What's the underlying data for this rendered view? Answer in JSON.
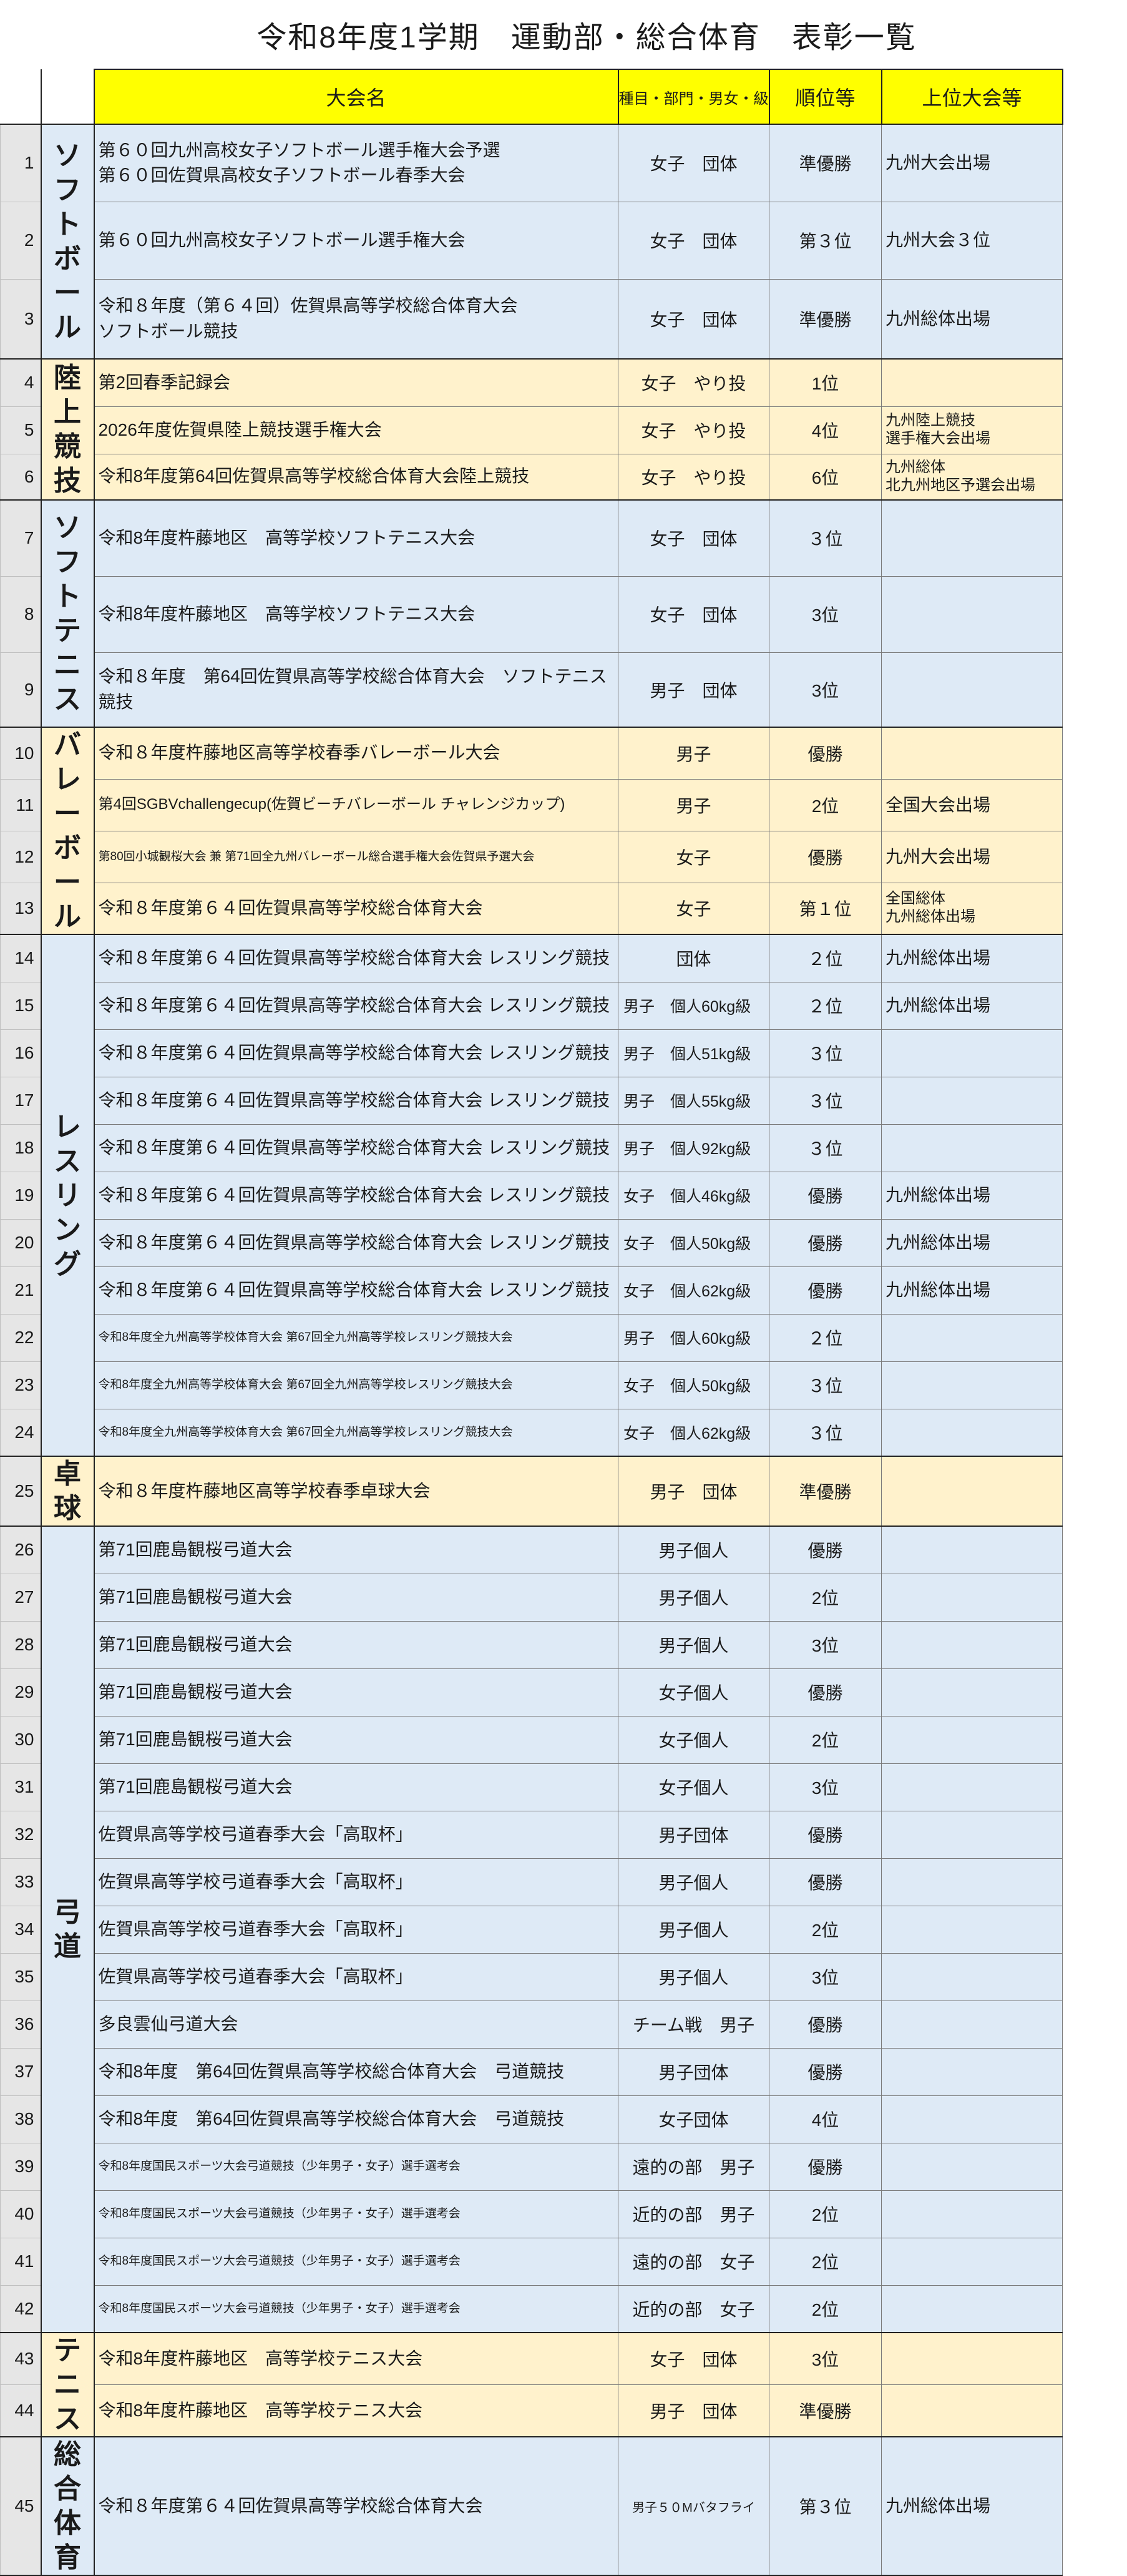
{
  "title": "令和8年度1学期　運動部・総合体育　表彰一覧",
  "columns": {
    "competition": "大会名",
    "category": "種目・部門・男女・級",
    "rank": "順位等",
    "upper": "上位大会等"
  },
  "colors": {
    "header": "#ffff00",
    "blue_group": "#deeaf6",
    "yellow_group": "#fff2cc",
    "number_column": "#e6e6e6"
  },
  "groups": [
    {
      "sport": "ソフトボール",
      "color": "blue",
      "rows": [
        {
          "no": "1",
          "competition": [
            "第６０回九州高校女子ソフトボール選手権大会予選",
            "第６０回佐賀県高校女子ソフトボール春季大会"
          ],
          "category": "女子　団体",
          "rank": "準優勝",
          "upper": [
            "九州大会出場"
          ]
        },
        {
          "no": "2",
          "competition": [
            "第６０回九州高校女子ソフトボール選手権大会"
          ],
          "category": "女子　団体",
          "rank": "第３位",
          "upper": [
            "九州大会３位"
          ]
        },
        {
          "no": "3",
          "competition": [
            "令和８年度（第６４回）佐賀県高等学校総合体育大会",
            "ソフトボール競技"
          ],
          "category": "女子　団体",
          "rank": "準優勝",
          "upper": [
            "九州総体出場"
          ]
        }
      ]
    },
    {
      "sport": "陸上競技",
      "color": "yellow",
      "rows": [
        {
          "no": "4",
          "competition": [
            "第2回春季記録会"
          ],
          "category": "女子　やり投",
          "rank": "1位",
          "upper": []
        },
        {
          "no": "5",
          "competition": [
            "2026年度佐賀県陸上競技選手権大会"
          ],
          "category": "女子　やり投",
          "rank": "4位",
          "upper": [
            "九州陸上競技",
            "選手権大会出場"
          ]
        },
        {
          "no": "6",
          "competition": [
            "令和8年度第64回佐賀県高等学校総合体育大会陸上競技"
          ],
          "category": "女子　やり投",
          "rank": "6位",
          "upper": [
            "九州総体",
            "北九州地区予選会出場"
          ]
        }
      ]
    },
    {
      "sport": "ソフトテニス",
      "color": "blue",
      "rows": [
        {
          "no": "7",
          "competition": [
            "令和8年度杵藤地区　高等学校ソフトテニス大会"
          ],
          "category": "女子　団体",
          "rank": "３位",
          "upper": []
        },
        {
          "no": "8",
          "competition": [
            "令和8年度杵藤地区　高等学校ソフトテニス大会"
          ],
          "category": "女子　団体",
          "rank": "3位",
          "upper": []
        },
        {
          "no": "9",
          "competition": [
            "令和８年度　第64回佐賀県高等学校総合体育大会　ソフトテニス",
            "競技"
          ],
          "category": "男子　団体",
          "rank": "3位",
          "upper": []
        }
      ]
    },
    {
      "sport": "バレーボール",
      "color": "yellow",
      "rows": [
        {
          "no": "10",
          "competition": [
            "令和８年度杵藤地区高等学校春季バレーボール大会"
          ],
          "category": "男子",
          "rank": "優勝",
          "upper": []
        },
        {
          "no": "11",
          "competition": [
            "第4回SGBVchallengecup(佐賀ビーチバレーボール チャレンジカップ)"
          ],
          "category": "男子",
          "rank": "2位",
          "upper": [
            "全国大会出場"
          ]
        },
        {
          "no": "12",
          "competition": [
            "第80回小城観桜大会 兼 第71回全九州バレーボール総合選手権大会佐賀県予選大会"
          ],
          "category": "女子",
          "rank": "優勝",
          "upper": [
            "九州大会出場"
          ]
        },
        {
          "no": "13",
          "competition": [
            "令和８年度第６４回佐賀県高等学校総合体育大会"
          ],
          "category": "女子",
          "rank": "第１位",
          "upper": [
            "全国総体",
            "九州総体出場"
          ]
        }
      ]
    },
    {
      "sport": "レスリング",
      "color": "blue",
      "rows": [
        {
          "no": "14",
          "competition": [
            "令和８年度第６４回佐賀県高等学校総合体育大会 レスリング競技"
          ],
          "category": "団体",
          "rank": "２位",
          "upper": [
            "九州総体出場"
          ]
        },
        {
          "no": "15",
          "competition": [
            "令和８年度第６４回佐賀県高等学校総合体育大会 レスリング競技"
          ],
          "category": "男子　個人60kg級",
          "rank": "２位",
          "upper": [
            "九州総体出場"
          ]
        },
        {
          "no": "16",
          "competition": [
            "令和８年度第６４回佐賀県高等学校総合体育大会 レスリング競技"
          ],
          "category": "男子　個人51kg級",
          "rank": "３位",
          "upper": []
        },
        {
          "no": "17",
          "competition": [
            "令和８年度第６４回佐賀県高等学校総合体育大会 レスリング競技"
          ],
          "category": "男子　個人55kg級",
          "rank": "３位",
          "upper": []
        },
        {
          "no": "18",
          "competition": [
            "令和８年度第６４回佐賀県高等学校総合体育大会 レスリング競技"
          ],
          "category": "男子　個人92kg級",
          "rank": "３位",
          "upper": []
        },
        {
          "no": "19",
          "competition": [
            "令和８年度第６４回佐賀県高等学校総合体育大会 レスリング競技"
          ],
          "category": "女子　個人46kg級",
          "rank": "優勝",
          "upper": [
            "九州総体出場"
          ]
        },
        {
          "no": "20",
          "competition": [
            "令和８年度第６４回佐賀県高等学校総合体育大会 レスリング競技"
          ],
          "category": "女子　個人50kg級",
          "rank": "優勝",
          "upper": [
            "九州総体出場"
          ]
        },
        {
          "no": "21",
          "competition": [
            "令和８年度第６４回佐賀県高等学校総合体育大会 レスリング競技"
          ],
          "category": "女子　個人62kg級",
          "rank": "優勝",
          "upper": [
            "九州総体出場"
          ]
        },
        {
          "no": "22",
          "competition": [
            "令和8年度全九州高等学校体育大会 第67回全九州高等学校レスリング競技大会"
          ],
          "category": "男子　個人60kg級",
          "rank": "２位",
          "upper": []
        },
        {
          "no": "23",
          "competition": [
            "令和8年度全九州高等学校体育大会 第67回全九州高等学校レスリング競技大会"
          ],
          "category": "女子　個人50kg級",
          "rank": "３位",
          "upper": []
        },
        {
          "no": "24",
          "competition": [
            "令和8年度全九州高等学校体育大会 第67回全九州高等学校レスリング競技大会"
          ],
          "category": "女子　個人62kg級",
          "rank": "３位",
          "upper": []
        }
      ]
    },
    {
      "sport": "卓球",
      "color": "yellow",
      "rows": [
        {
          "no": "25",
          "competition": [
            "令和８年度杵藤地区高等学校春季卓球大会"
          ],
          "category": "男子　団体",
          "rank": "準優勝",
          "upper": []
        }
      ]
    },
    {
      "sport": "弓道",
      "color": "blue",
      "rows": [
        {
          "no": "26",
          "competition": [
            "第71回鹿島観桜弓道大会"
          ],
          "category": "男子個人",
          "rank": "優勝",
          "upper": []
        },
        {
          "no": "27",
          "competition": [
            "第71回鹿島観桜弓道大会"
          ],
          "category": "男子個人",
          "rank": "2位",
          "upper": []
        },
        {
          "no": "28",
          "competition": [
            "第71回鹿島観桜弓道大会"
          ],
          "category": "男子個人",
          "rank": "3位",
          "upper": []
        },
        {
          "no": "29",
          "competition": [
            "第71回鹿島観桜弓道大会"
          ],
          "category": "女子個人",
          "rank": "優勝",
          "upper": []
        },
        {
          "no": "30",
          "competition": [
            "第71回鹿島観桜弓道大会"
          ],
          "category": "女子個人",
          "rank": "2位",
          "upper": []
        },
        {
          "no": "31",
          "competition": [
            "第71回鹿島観桜弓道大会"
          ],
          "category": "女子個人",
          "rank": "3位",
          "upper": []
        },
        {
          "no": "32",
          "competition": [
            "佐賀県高等学校弓道春季大会「高取杯」"
          ],
          "category": "男子団体",
          "rank": "優勝",
          "upper": []
        },
        {
          "no": "33",
          "competition": [
            "佐賀県高等学校弓道春季大会「高取杯」"
          ],
          "category": "男子個人",
          "rank": "優勝",
          "upper": []
        },
        {
          "no": "34",
          "competition": [
            "佐賀県高等学校弓道春季大会「高取杯」"
          ],
          "category": "男子個人",
          "rank": "2位",
          "upper": []
        },
        {
          "no": "35",
          "competition": [
            "佐賀県高等学校弓道春季大会「高取杯」"
          ],
          "category": "男子個人",
          "rank": "3位",
          "upper": []
        },
        {
          "no": "36",
          "competition": [
            "多良雲仙弓道大会"
          ],
          "category": "チーム戦　男子",
          "rank": "優勝",
          "upper": []
        },
        {
          "no": "37",
          "competition": [
            "令和8年度　第64回佐賀県高等学校総合体育大会　弓道競技"
          ],
          "category": "男子団体",
          "rank": "優勝",
          "upper": []
        },
        {
          "no": "38",
          "competition": [
            "令和8年度　第64回佐賀県高等学校総合体育大会　弓道競技"
          ],
          "category": "女子団体",
          "rank": "4位",
          "upper": []
        },
        {
          "no": "39",
          "competition": [
            "令和8年度国民スポーツ大会弓道競技（少年男子・女子）選手選考会"
          ],
          "category": "遠的の部　男子",
          "rank": "優勝",
          "upper": []
        },
        {
          "no": "40",
          "competition": [
            "令和8年度国民スポーツ大会弓道競技（少年男子・女子）選手選考会"
          ],
          "category": "近的の部　男子",
          "rank": "2位",
          "upper": []
        },
        {
          "no": "41",
          "competition": [
            "令和8年度国民スポーツ大会弓道競技（少年男子・女子）選手選考会"
          ],
          "category": "遠的の部　女子",
          "rank": "2位",
          "upper": []
        },
        {
          "no": "42",
          "competition": [
            "令和8年度国民スポーツ大会弓道競技（少年男子・女子）選手選考会"
          ],
          "category": "近的の部　女子",
          "rank": "2位",
          "upper": []
        }
      ]
    },
    {
      "sport": "テニス",
      "color": "yellow",
      "rows": [
        {
          "no": "43",
          "competition": [
            "令和8年度杵藤地区　高等学校テニス大会"
          ],
          "category": "女子　団体",
          "rank": "3位",
          "upper": []
        },
        {
          "no": "44",
          "competition": [
            "令和8年度杵藤地区　高等学校テニス大会"
          ],
          "category": "男子　団体",
          "rank": "準優勝",
          "upper": []
        }
      ]
    },
    {
      "sport": "総合体育",
      "color": "blue",
      "rows": [
        {
          "no": "45",
          "competition": [
            "令和８年度第６４回佐賀県高等学校総合体育大会"
          ],
          "category": "男子５０Mバタフライ",
          "rank": "第３位",
          "upper": [
            "九州総体出場"
          ]
        }
      ]
    }
  ]
}
